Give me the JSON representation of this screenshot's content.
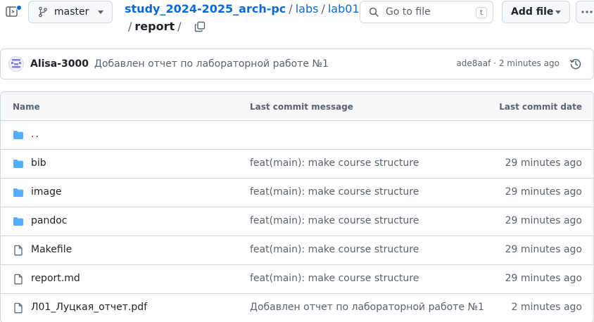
{
  "colors": {
    "accent": "#0969da",
    "folder": "#54aeff",
    "border": "#d0d7de",
    "muted": "#59636e",
    "text": "#1f2328",
    "header_bg": "#f6f8fa"
  },
  "header": {
    "branch": "master",
    "breadcrumb": {
      "repo": "study_2024-2025_arch-pc",
      "sep": "/",
      "parts": [
        "labs",
        "lab01"
      ],
      "current": "report"
    },
    "goto_file": {
      "placeholder": "Go to file",
      "shortcut": "t"
    },
    "add_file_label": "Add file"
  },
  "commit": {
    "author": "Alisa-3000",
    "message": "Добавлен отчет по лабораторной работе №1",
    "sha": "ade8aaf",
    "separator": "·",
    "time": "2 minutes ago"
  },
  "table": {
    "headers": {
      "name": "Name",
      "message": "Last commit message",
      "date": "Last commit date"
    },
    "rows": [
      {
        "name": "..",
        "type": "folder",
        "message": "",
        "date": ""
      },
      {
        "name": "bib",
        "type": "folder",
        "message": "feat(main): make course structure",
        "date": "29 minutes ago"
      },
      {
        "name": "image",
        "type": "folder",
        "message": "feat(main): make course structure",
        "date": "29 minutes ago"
      },
      {
        "name": "pandoc",
        "type": "folder",
        "message": "feat(main): make course structure",
        "date": "29 minutes ago"
      },
      {
        "name": "Makefile",
        "type": "file",
        "message": "feat(main): make course structure",
        "date": "29 minutes ago"
      },
      {
        "name": "report.md",
        "type": "file",
        "message": "feat(main): make course structure",
        "date": "29 minutes ago"
      },
      {
        "name": "Л01_Луцкая_отчет.pdf",
        "type": "file",
        "message": "Добавлен отчет по лабораторной работе №1",
        "date": "2 minutes ago"
      }
    ]
  }
}
